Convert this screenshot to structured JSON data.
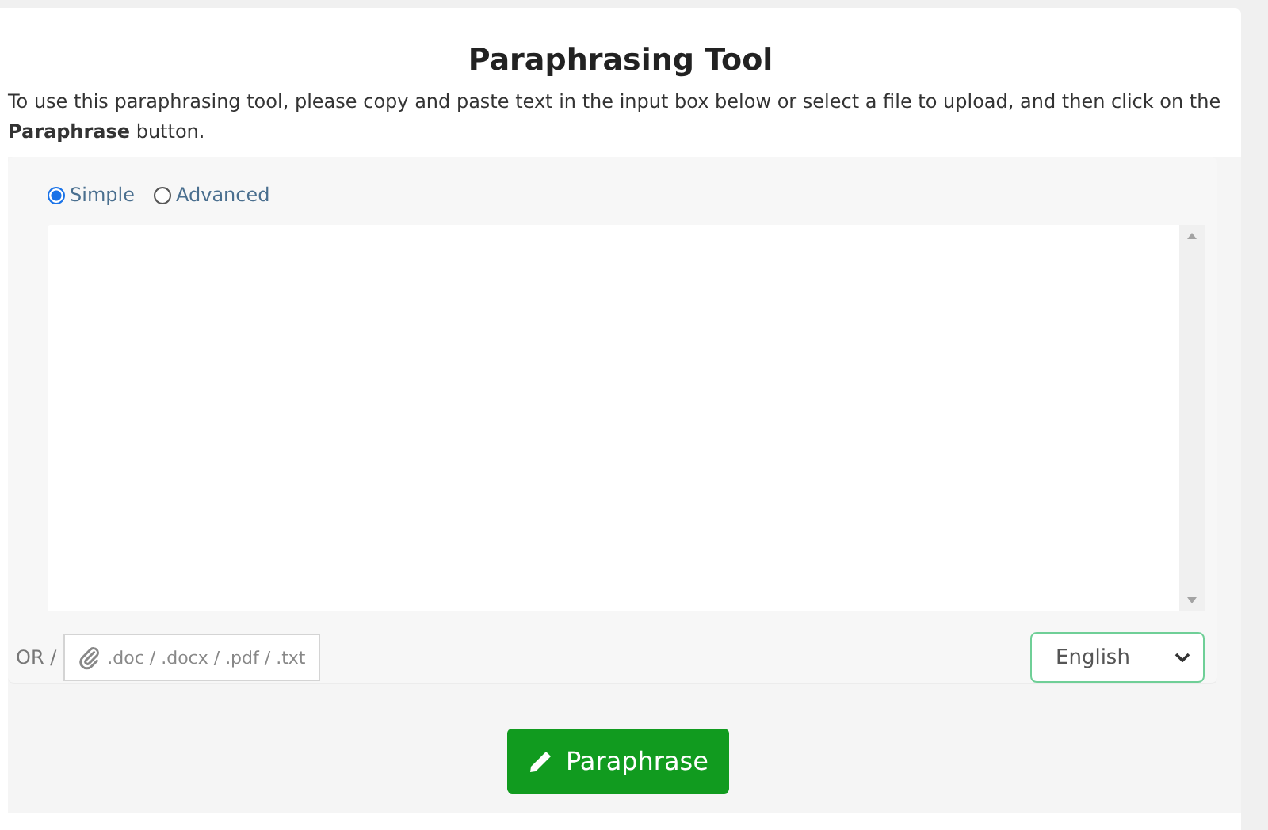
{
  "title": "Paraphrasing Tool",
  "description": "To use this paraphrasing tool, please copy and paste text in the input box below or select a file to upload, and then click on the **Paraphrase** button.",
  "modes": [
    {
      "label": "Simple",
      "selected": true
    },
    {
      "label": "Advanced",
      "selected": false
    }
  ],
  "upload": {
    "prefix": "OR /",
    "placeholder": ".doc / .docx / .pdf / .txt"
  },
  "language": {
    "value": "English"
  },
  "submit": {
    "label": "Paraphrase"
  }
}
